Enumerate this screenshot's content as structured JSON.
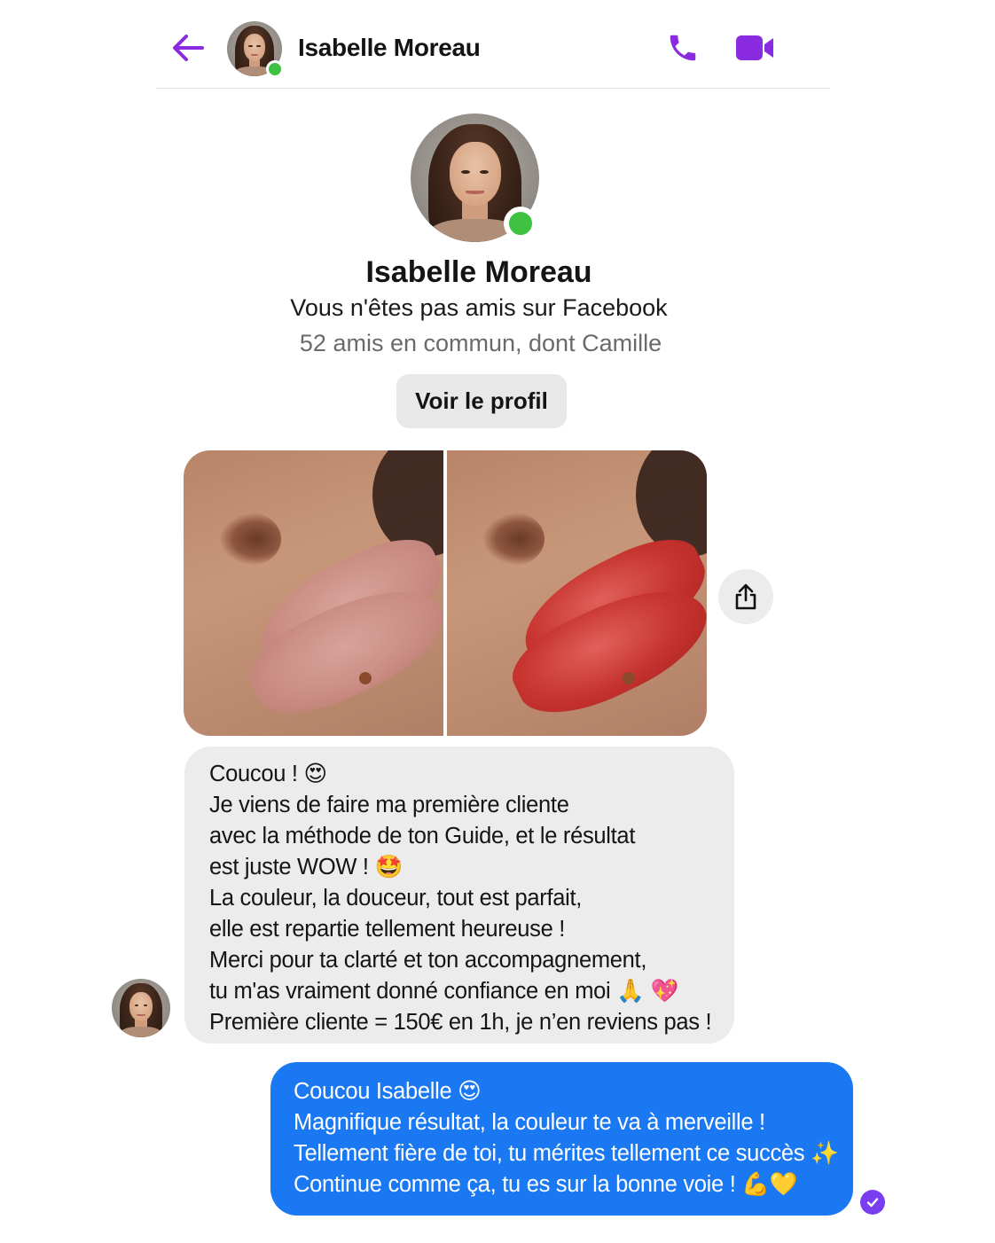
{
  "header": {
    "contact_name": "Isabelle Moreau",
    "icons": {
      "back": "back-arrow-icon",
      "call": "phone-icon",
      "video": "video-camera-icon"
    },
    "accent_color": "#8a2be2",
    "online_color": "#3fc241"
  },
  "profile": {
    "name": "Isabelle Moreau",
    "relationship": "Vous n'êtes pas amis sur Facebook",
    "mutual_friends": "52 amis en commun, dont Camille",
    "view_profile_label": "Voir le profil"
  },
  "attachment": {
    "photos": [
      "before-lips-photo",
      "after-lips-photo"
    ],
    "share_icon": "share-icon"
  },
  "messages": [
    {
      "direction": "incoming",
      "bubble_color": "#ececec",
      "lines": [
        "Coucou ! 😍",
        "Je viens de faire ma première cliente",
        "avec la méthode de ton Guide, et le résultat",
        "est juste WOW ! 🤩",
        "La couleur, la douceur, tout est parfait,",
        "elle est repartie tellement heureuse !",
        "Merci pour ta clarté et ton accompagnement,",
        "tu m'as vraiment donné confiance en moi 🙏 💖",
        "Première cliente = 150€ en 1h, je n’en reviens pas !"
      ]
    },
    {
      "direction": "outgoing",
      "bubble_color": "#1a78f2",
      "lines": [
        "Coucou Isabelle 😍",
        "Magnifique résultat, la couleur te va à merveille !",
        "Tellement fière de toi, tu mérites tellement ce succès ✨",
        "Continue comme ça, tu es sur la bonne voie ! 💪💛"
      ],
      "status_icon": "read-check-icon",
      "status_color": "#7a3ef0"
    }
  ]
}
